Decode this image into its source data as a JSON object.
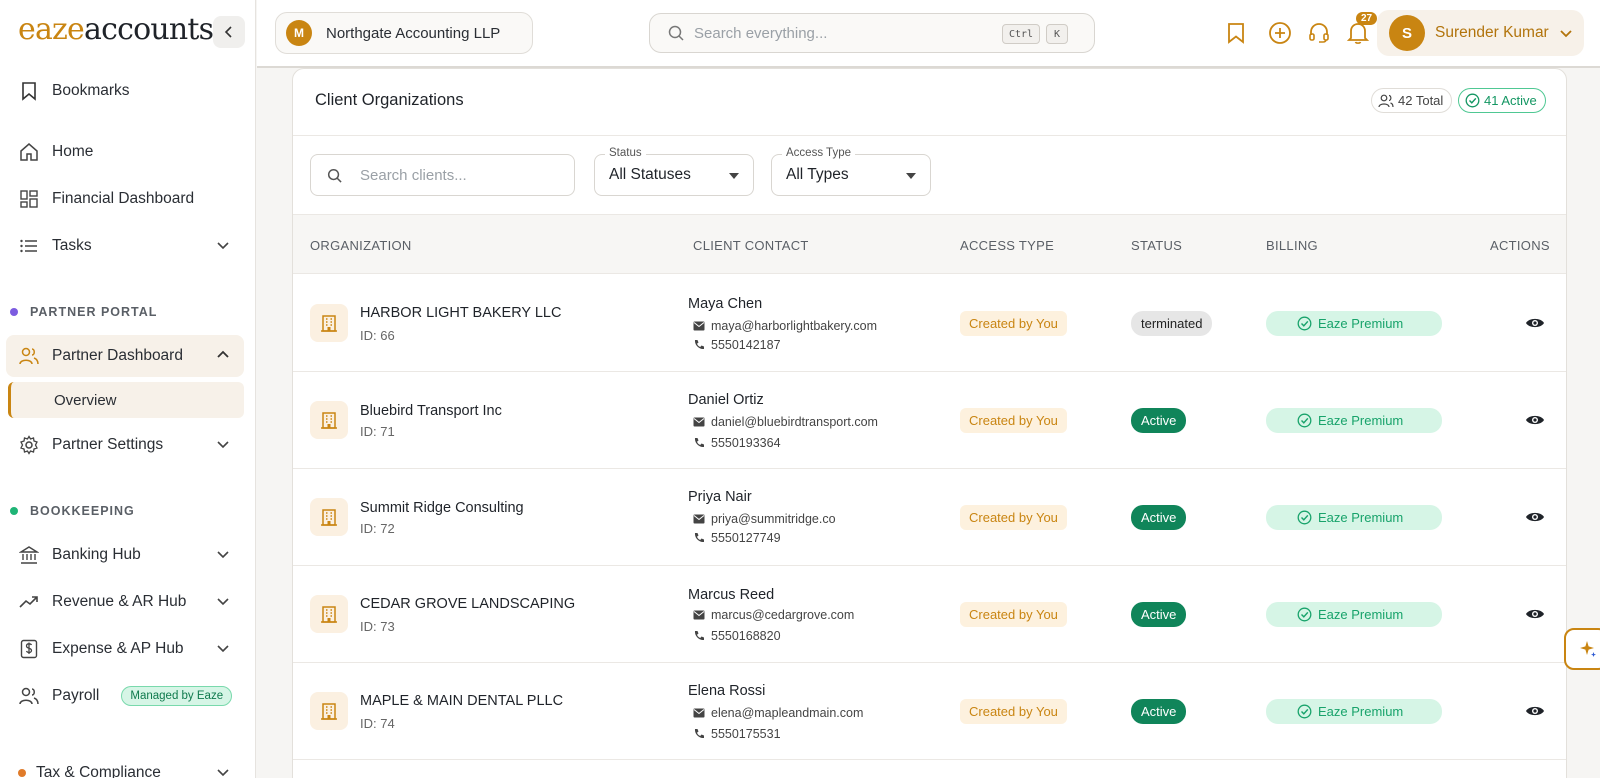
{
  "brand": {
    "prefix": "eaze",
    "suffix": "accounts"
  },
  "sidebar": {
    "bookmarks": "Bookmarks",
    "home": "Home",
    "financial_dashboard": "Financial Dashboard",
    "tasks": "Tasks",
    "section_partner": "PARTNER PORTAL",
    "partner_dashboard": "Partner Dashboard",
    "overview": "Overview",
    "partner_settings": "Partner Settings",
    "section_bookkeeping": "BOOKKEEPING",
    "banking_hub": "Banking Hub",
    "revenue_hub": "Revenue & AR Hub",
    "expense_hub": "Expense & AP Hub",
    "payroll": "Payroll",
    "payroll_badge": "Managed by Eaze",
    "tax": "Tax & Compliance"
  },
  "topbar": {
    "org_initial": "M",
    "org_name": "Northgate Accounting LLP",
    "search_placeholder": "Search everything...",
    "kbd_ctrl": "Ctrl",
    "kbd_k": "K",
    "notification_count": "27",
    "user_initial": "S",
    "user_name": "Surender Kumar"
  },
  "clients": {
    "title": "Client Organizations",
    "total_label": "42 Total",
    "active_label": "41 Active",
    "search_placeholder": "Search clients...",
    "status_filter": {
      "label": "Status",
      "value": "All Statuses"
    },
    "access_filter": {
      "label": "Access Type",
      "value": "All Types"
    },
    "columns": {
      "organization": "ORGANIZATION",
      "contact": "CLIENT CONTACT",
      "access": "ACCESS TYPE",
      "status": "STATUS",
      "billing": "BILLING",
      "actions": "ACTIONS"
    },
    "rows": [
      {
        "name": "HARBOR LIGHT BAKERY LLC",
        "id": "ID: 66",
        "contact": "Maya Chen",
        "email": "maya@harborlightbakery.com",
        "phone": "5550142187",
        "access": "Created by You",
        "status": "terminated",
        "billing": "Eaze Premium"
      },
      {
        "name": "Bluebird Transport Inc",
        "id": "ID: 71",
        "contact": "Daniel Ortiz",
        "email": "daniel@bluebirdtransport.com",
        "phone": "5550193364",
        "access": "Created by You",
        "status": "Active",
        "billing": "Eaze Premium"
      },
      {
        "name": "Summit Ridge Consulting",
        "id": "ID: 72",
        "contact": "Priya Nair",
        "email": "priya@summitridge.co",
        "phone": "5550127749",
        "access": "Created by You",
        "status": "Active",
        "billing": "Eaze Premium"
      },
      {
        "name": "CEDAR GROVE LANDSCAPING",
        "id": "ID: 73",
        "contact": "Marcus Reed",
        "email": "marcus@cedargrove.com",
        "phone": "5550168820",
        "access": "Created by You",
        "status": "Active",
        "billing": "Eaze Premium"
      },
      {
        "name": "MAPLE & MAIN DENTAL PLLC",
        "id": "ID: 74",
        "contact": "Elena Rossi",
        "email": "elena@mapleandmain.com",
        "phone": "5550175531",
        "access": "Created by You",
        "status": "Active",
        "billing": "Eaze Premium"
      }
    ]
  },
  "colors": {
    "accent": "#c98512",
    "active_green": "#10855a",
    "billing_bg": "#d6f5e6"
  }
}
